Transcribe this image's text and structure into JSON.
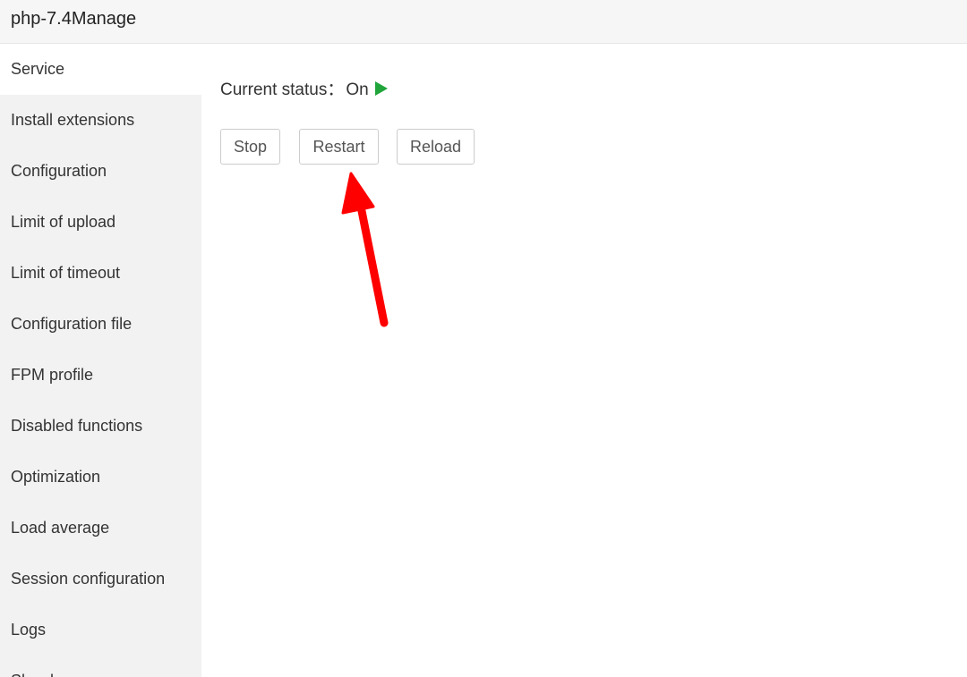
{
  "window": {
    "title": "php-7.4Manage"
  },
  "sidebar": {
    "items": [
      {
        "label": "Service",
        "active": true
      },
      {
        "label": "Install extensions"
      },
      {
        "label": "Configuration"
      },
      {
        "label": "Limit of upload"
      },
      {
        "label": "Limit of timeout"
      },
      {
        "label": "Configuration file"
      },
      {
        "label": "FPM profile"
      },
      {
        "label": "Disabled functions"
      },
      {
        "label": "Optimization"
      },
      {
        "label": "Load average"
      },
      {
        "label": "Session configuration"
      },
      {
        "label": "Logs"
      },
      {
        "label": "Slow logs"
      }
    ]
  },
  "main": {
    "status_label": "Current status：",
    "status_value": "On",
    "status_icon": "play-icon",
    "status_color": "#20a53a",
    "buttons": {
      "stop": "Stop",
      "restart": "Restart",
      "reload": "Reload"
    }
  },
  "annotation": {
    "color": "#ff0000",
    "icon": "red-arrow"
  }
}
